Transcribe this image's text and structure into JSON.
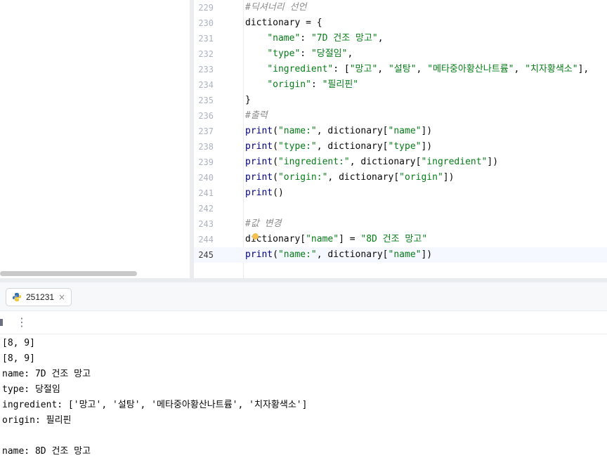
{
  "editor": {
    "lines": [
      {
        "no": "229",
        "tokens": [
          {
            "c": "cm",
            "t": "#딕셔너리 선언"
          }
        ]
      },
      {
        "no": "230",
        "tokens": [
          {
            "c": "id",
            "t": "dictionary = {"
          }
        ]
      },
      {
        "no": "231",
        "tokens": [
          {
            "c": "id",
            "t": "    "
          },
          {
            "c": "st",
            "t": "\"name\""
          },
          {
            "c": "id",
            "t": ": "
          },
          {
            "c": "st",
            "t": "\"7D 건조 망고\""
          },
          {
            "c": "id",
            "t": ","
          }
        ]
      },
      {
        "no": "232",
        "tokens": [
          {
            "c": "id",
            "t": "    "
          },
          {
            "c": "st",
            "t": "\"type\""
          },
          {
            "c": "id",
            "t": ": "
          },
          {
            "c": "st",
            "t": "\"당절임\""
          },
          {
            "c": "id",
            "t": ","
          }
        ]
      },
      {
        "no": "233",
        "tokens": [
          {
            "c": "id",
            "t": "    "
          },
          {
            "c": "st",
            "t": "\"ingredient\""
          },
          {
            "c": "id",
            "t": ": ["
          },
          {
            "c": "st",
            "t": "\"망고\""
          },
          {
            "c": "id",
            "t": ", "
          },
          {
            "c": "st",
            "t": "\"설탕\""
          },
          {
            "c": "id",
            "t": ", "
          },
          {
            "c": "st",
            "t": "\"메타중아황산나트륨\""
          },
          {
            "c": "id",
            "t": ", "
          },
          {
            "c": "st",
            "t": "\"치자황색소\""
          },
          {
            "c": "id",
            "t": "],"
          }
        ]
      },
      {
        "no": "234",
        "tokens": [
          {
            "c": "id",
            "t": "    "
          },
          {
            "c": "st",
            "t": "\"origin\""
          },
          {
            "c": "id",
            "t": ": "
          },
          {
            "c": "st",
            "t": "\"필리핀\""
          }
        ]
      },
      {
        "no": "235",
        "tokens": [
          {
            "c": "id",
            "t": "}"
          }
        ]
      },
      {
        "no": "236",
        "tokens": [
          {
            "c": "cm",
            "t": "#출력"
          }
        ]
      },
      {
        "no": "237",
        "tokens": [
          {
            "c": "bi",
            "t": "print"
          },
          {
            "c": "id",
            "t": "("
          },
          {
            "c": "st",
            "t": "\"name:\""
          },
          {
            "c": "id",
            "t": ", dictionary["
          },
          {
            "c": "st",
            "t": "\"name\""
          },
          {
            "c": "id",
            "t": "])"
          }
        ]
      },
      {
        "no": "238",
        "tokens": [
          {
            "c": "bi",
            "t": "print"
          },
          {
            "c": "id",
            "t": "("
          },
          {
            "c": "st",
            "t": "\"type:\""
          },
          {
            "c": "id",
            "t": ", dictionary["
          },
          {
            "c": "st",
            "t": "\"type\""
          },
          {
            "c": "id",
            "t": "])"
          }
        ]
      },
      {
        "no": "239",
        "tokens": [
          {
            "c": "bi",
            "t": "print"
          },
          {
            "c": "id",
            "t": "("
          },
          {
            "c": "st",
            "t": "\"ingredient:\""
          },
          {
            "c": "id",
            "t": ", dictionary["
          },
          {
            "c": "st",
            "t": "\"ingredient\""
          },
          {
            "c": "id",
            "t": "])"
          }
        ]
      },
      {
        "no": "240",
        "tokens": [
          {
            "c": "bi",
            "t": "print"
          },
          {
            "c": "id",
            "t": "("
          },
          {
            "c": "st",
            "t": "\"origin:\""
          },
          {
            "c": "id",
            "t": ", dictionary["
          },
          {
            "c": "st",
            "t": "\"origin\""
          },
          {
            "c": "id",
            "t": "])"
          }
        ]
      },
      {
        "no": "241",
        "tokens": [
          {
            "c": "bi",
            "t": "print"
          },
          {
            "c": "id",
            "t": "()"
          }
        ]
      },
      {
        "no": "242",
        "tokens": []
      },
      {
        "no": "243",
        "tokens": [
          {
            "c": "cm",
            "t": "#값 변경"
          }
        ]
      },
      {
        "no": "244",
        "tokens": [
          {
            "c": "id",
            "t": "dictionary["
          },
          {
            "c": "st",
            "t": "\"name\""
          },
          {
            "c": "id",
            "t": "] = "
          },
          {
            "c": "st",
            "t": "\"8D 건조 망고\""
          }
        ]
      },
      {
        "no": "245",
        "current": true,
        "tokens": [
          {
            "c": "bi",
            "t": "print"
          },
          {
            "c": "id",
            "t": "("
          },
          {
            "c": "st",
            "t": "\"name:\""
          },
          {
            "c": "id",
            "t": ", dictionary["
          },
          {
            "c": "st",
            "t": "\"name\""
          },
          {
            "c": "id",
            "t": "])"
          }
        ]
      }
    ]
  },
  "run_panel": {
    "tab_label": "251231",
    "tab_icon": "python-icon",
    "close_glyph": "×",
    "more_glyph": "⋮"
  },
  "console": {
    "lines": [
      "[8, 9]",
      "[8, 9]",
      "name: 7D 건조 망고",
      "type: 당절임",
      "ingredient: ['망고', '설탕', '메타중아황산나트륨', '치자황색소']",
      "origin: 필리핀",
      "",
      "name: 8D 건조 망고"
    ]
  },
  "colors": {
    "keyword": "#0033b3",
    "builtin": "#000080",
    "string": "#067d17",
    "comment": "#8c8c8c",
    "bulb": "#f2c14e"
  }
}
